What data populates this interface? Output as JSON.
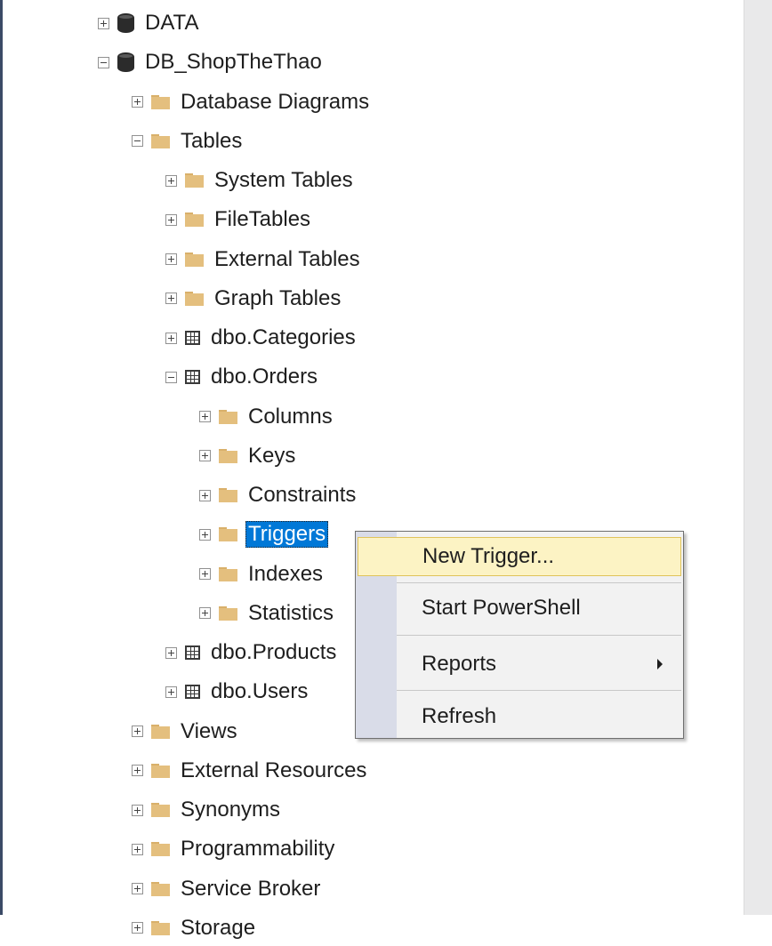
{
  "tree": {
    "nodes": [
      {
        "label": "DATA",
        "expander": "plus",
        "icon": "database-icon"
      },
      {
        "label": "DB_ShopTheThao",
        "expander": "minus",
        "icon": "database-icon"
      },
      {
        "label": "Database Diagrams",
        "expander": "plus",
        "icon": "folder-icon"
      },
      {
        "label": "Tables",
        "expander": "minus",
        "icon": "folder-icon"
      },
      {
        "label": "System Tables",
        "expander": "plus",
        "icon": "folder-icon"
      },
      {
        "label": "FileTables",
        "expander": "plus",
        "icon": "folder-icon"
      },
      {
        "label": "External Tables",
        "expander": "plus",
        "icon": "folder-icon"
      },
      {
        "label": "Graph Tables",
        "expander": "plus",
        "icon": "folder-icon"
      },
      {
        "label": "dbo.Categories",
        "expander": "plus",
        "icon": "table-icon"
      },
      {
        "label": "dbo.Orders",
        "expander": "minus",
        "icon": "table-icon"
      },
      {
        "label": "Columns",
        "expander": "plus",
        "icon": "folder-icon"
      },
      {
        "label": "Keys",
        "expander": "plus",
        "icon": "folder-icon"
      },
      {
        "label": "Constraints",
        "expander": "plus",
        "icon": "folder-icon"
      },
      {
        "label": "Triggers",
        "expander": "plus",
        "icon": "folder-icon",
        "selected": true
      },
      {
        "label": "Indexes",
        "expander": "plus",
        "icon": "folder-icon"
      },
      {
        "label": "Statistics",
        "expander": "plus",
        "icon": "folder-icon"
      },
      {
        "label": "dbo.Products",
        "expander": "plus",
        "icon": "table-icon"
      },
      {
        "label": "dbo.Users",
        "expander": "plus",
        "icon": "table-icon"
      },
      {
        "label": "Views",
        "expander": "plus",
        "icon": "folder-icon"
      },
      {
        "label": "External Resources",
        "expander": "plus",
        "icon": "folder-icon"
      },
      {
        "label": "Synonyms",
        "expander": "plus",
        "icon": "folder-icon"
      },
      {
        "label": "Programmability",
        "expander": "plus",
        "icon": "folder-icon"
      },
      {
        "label": "Service Broker",
        "expander": "plus",
        "icon": "folder-icon"
      },
      {
        "label": "Storage",
        "expander": "plus",
        "icon": "folder-icon"
      }
    ]
  },
  "context_menu": {
    "items": [
      {
        "label": "New Trigger...",
        "highlighted": true
      },
      {
        "label": "Start PowerShell"
      },
      {
        "label": "Reports",
        "submenu": true
      },
      {
        "label": "Refresh"
      }
    ]
  },
  "colors": {
    "selection": "#0078d7",
    "menu_highlight": "#fcf3c4",
    "folder": "#e4bf7e"
  }
}
